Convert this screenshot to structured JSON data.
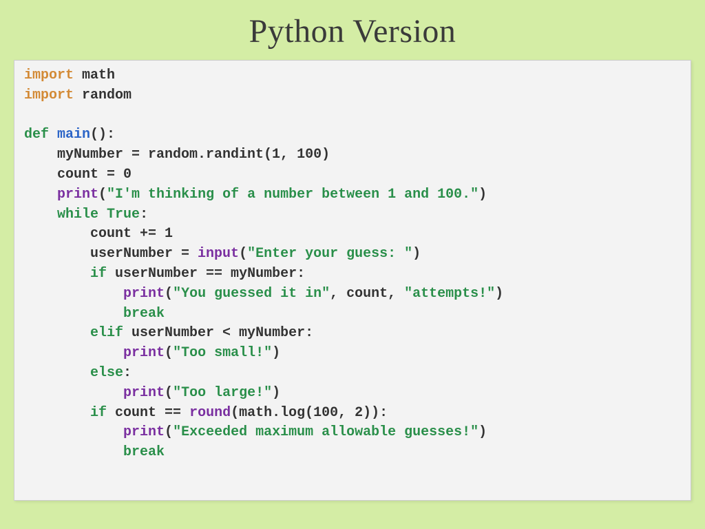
{
  "title": "Python Version",
  "code": {
    "l01_kw": "import",
    "l01_rest": " math",
    "l02_kw": "import",
    "l02_rest": " random",
    "l03": "",
    "l04_def": "def",
    "l04_fn": " main",
    "l04_rest": "():",
    "l05": "    myNumber = random.randint(1, 100)",
    "l06": "    count = 0",
    "l07_pad": "    ",
    "l07_fn": "print",
    "l07_open": "(",
    "l07_str": "\"I'm thinking of a number between 1 and 100.\"",
    "l07_close": ")",
    "l08_pad": "    ",
    "l08_kw": "while",
    "l08_sp": " ",
    "l08_true": "True",
    "l08_colon": ":",
    "l09": "        count += 1",
    "l10_pad": "        ",
    "l10_lhs": "userNumber = ",
    "l10_fn": "input",
    "l10_open": "(",
    "l10_str": "\"Enter your guess: \"",
    "l10_close": ")",
    "l11_pad": "        ",
    "l11_kw": "if",
    "l11_rest": " userNumber == myNumber:",
    "l12_pad": "            ",
    "l12_fn": "print",
    "l12_open": "(",
    "l12_s1": "\"You guessed it in\"",
    "l12_mid": ", count, ",
    "l12_s2": "\"attempts!\"",
    "l12_close": ")",
    "l13_pad": "            ",
    "l13_kw": "break",
    "l14_pad": "        ",
    "l14_kw": "elif",
    "l14_rest": " userNumber < myNumber:",
    "l15_pad": "            ",
    "l15_fn": "print",
    "l15_open": "(",
    "l15_str": "\"Too small!\"",
    "l15_close": ")",
    "l16_pad": "        ",
    "l16_kw": "else",
    "l16_colon": ":",
    "l17_pad": "            ",
    "l17_fn": "print",
    "l17_open": "(",
    "l17_str": "\"Too large!\"",
    "l17_close": ")",
    "l18_pad": "        ",
    "l18_kw": "if",
    "l18_mid": " count == ",
    "l18_fn": "round",
    "l18_rest": "(math.log(100, 2)):",
    "l19_pad": "            ",
    "l19_fn": "print",
    "l19_open": "(",
    "l19_str": "\"Exceeded maximum allowable guesses!\"",
    "l19_close": ")",
    "l20_pad": "            ",
    "l20_kw": "break"
  },
  "colors": {
    "slide_bg": "#d4eda5",
    "panel_bg": "#f3f3f3",
    "keyword_import": "#d38a36",
    "keyword_control": "#2a8f4a",
    "function_name": "#2b64c7",
    "builtin": "#7a2fa0",
    "string": "#2a8f4a",
    "text": "#333333"
  }
}
